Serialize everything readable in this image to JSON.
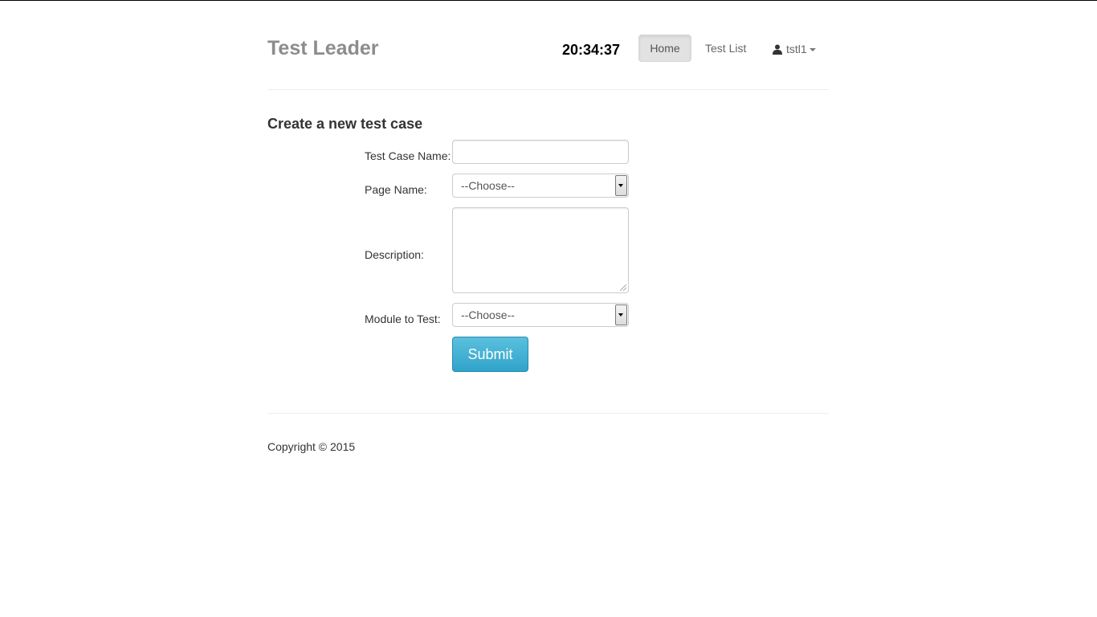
{
  "header": {
    "brand": "Test Leader",
    "clock": "20:34:37",
    "nav": {
      "home": "Home",
      "test_list": "Test List",
      "user": "tstl1"
    }
  },
  "form": {
    "title": "Create a new test case",
    "test_case_name_label": "Test Case Name:",
    "test_case_name_value": "",
    "page_name_label": "Page Name:",
    "page_name_selected": "--Choose--",
    "description_label": "Description:",
    "description_value": "",
    "module_label": "Module to Test:",
    "module_selected": "--Choose--",
    "submit_label": "Submit"
  },
  "footer": {
    "copyright": "Copyright © 2015"
  },
  "colors": {
    "brand": "#8c8c8c",
    "submit": "#39b3d7",
    "active_nav_bg": "#e2e2e2"
  }
}
